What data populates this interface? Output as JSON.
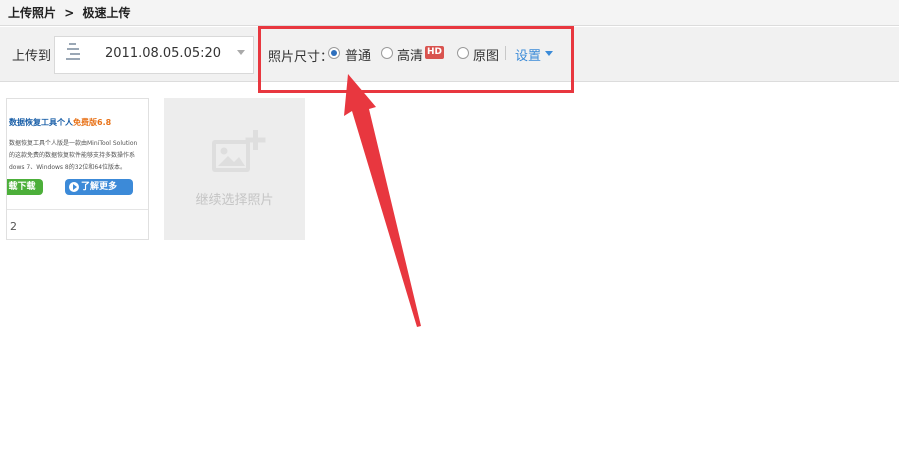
{
  "breadcrumb": {
    "parent": "上传照片",
    "separator": ">",
    "current": "极速上传"
  },
  "toolbar": {
    "upload_to_label": "上传到",
    "album": {
      "name": "2011.08.05.05:20",
      "caret_icon": "chevron-down-icon"
    },
    "photo_size": {
      "label": "照片尺寸：",
      "options": [
        {
          "label": "普通",
          "checked": true
        },
        {
          "label": "高清",
          "badge": "HD",
          "checked": false
        },
        {
          "label": "原图",
          "checked": false
        }
      ]
    },
    "settings_label": "设置"
  },
  "photos": [
    {
      "ad": {
        "title_prefix": "数据恢复工具个人",
        "title_free": "免费版",
        "title_version": "6.8",
        "lines": [
          "数据恢复工具个人版是一款由MiniTool Solution",
          "的这款免费的数据恢复软件能够支持多数操作系",
          "dows 7、Windows 8的32位和64位版本。"
        ],
        "download_label": "载下载",
        "more_label": "了解更多"
      },
      "number": "2"
    }
  ],
  "add_more": {
    "label": "继续选择照片",
    "icon": "add-photo-icon"
  },
  "colors": {
    "accent": "#3b8bd8",
    "highlight": "#e8373f",
    "hd_badge": "#d9534f"
  }
}
